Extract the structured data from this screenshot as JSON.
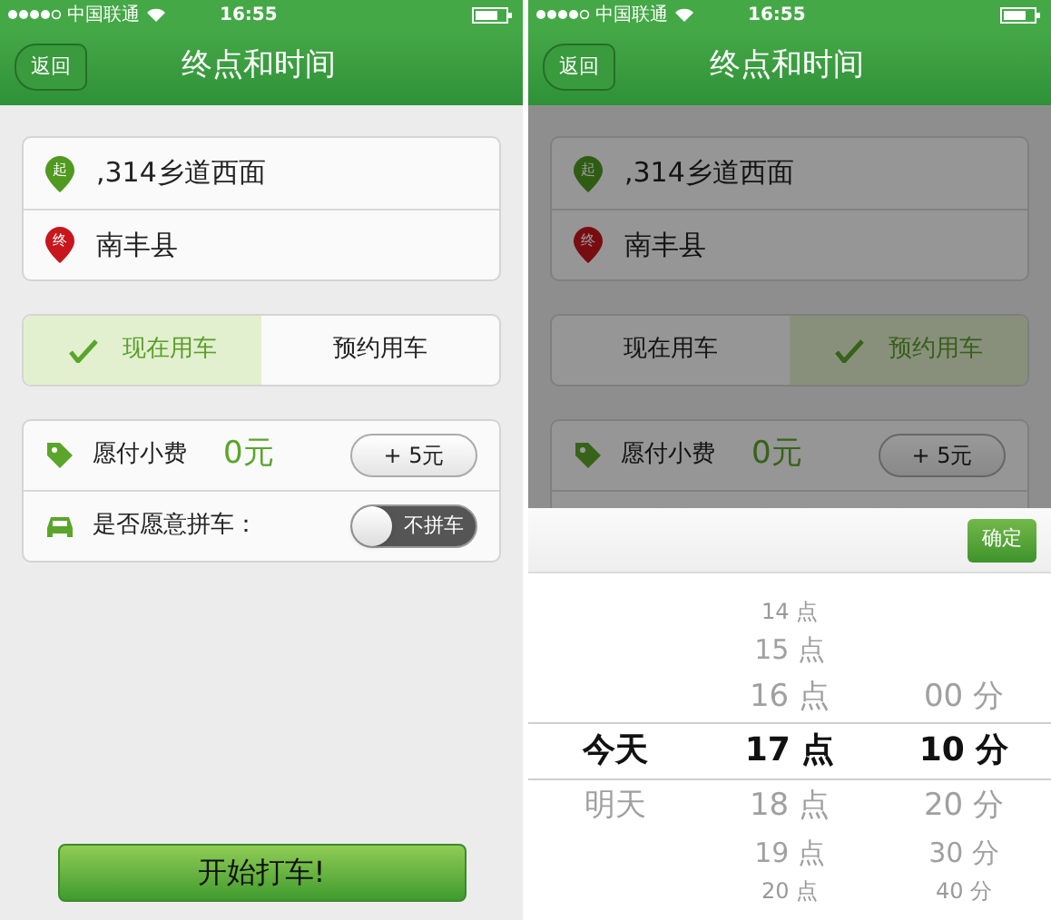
{
  "screens": [
    {
      "dimmed": false,
      "status_bar": {
        "carrier": "中国联通",
        "time": "16:55"
      },
      "nav": {
        "back": "返回",
        "title": "终点和时间"
      },
      "addresses": [
        {
          "kind": "start",
          "badge": "起",
          "text": ",314乡道西面"
        },
        {
          "kind": "end",
          "badge": "终",
          "text": "南丰县"
        }
      ],
      "mode_tabs": [
        {
          "label": "现在用车",
          "selected": true
        },
        {
          "label": "预约用车",
          "selected": false
        }
      ],
      "fee": {
        "label": "愿付小费",
        "value": "0元",
        "button": "+ 5元"
      },
      "carpool": {
        "label": "是否愿意拼车：",
        "switch_label": "不拼车",
        "on": false
      },
      "submit_button": "开始打车!"
    },
    {
      "dimmed": true,
      "status_bar": {
        "carrier": "中国联通",
        "time": "16:55"
      },
      "nav": {
        "back": "返回",
        "title": "终点和时间"
      },
      "addresses": [
        {
          "kind": "start",
          "badge": "起",
          "text": ",314乡道西面"
        },
        {
          "kind": "end",
          "badge": "终",
          "text": "南丰县"
        }
      ],
      "mode_tabs": [
        {
          "label": "现在用车",
          "selected": false
        },
        {
          "label": "预约用车",
          "selected": true
        }
      ],
      "fee": {
        "label": "愿付小费",
        "value": "0元",
        "button": "+ 5元"
      },
      "picker": {
        "confirm": "确定",
        "columns": [
          {
            "items": [
              {
                "label": "今天",
                "selected": true
              },
              {
                "label": "明天",
                "selected": false
              }
            ]
          },
          {
            "items": [
              {
                "label": "14 点",
                "selected": false
              },
              {
                "label": "15 点",
                "selected": false
              },
              {
                "label": "16 点",
                "selected": false
              },
              {
                "label": "17 点",
                "selected": true
              },
              {
                "label": "18 点",
                "selected": false
              },
              {
                "label": "19 点",
                "selected": false
              },
              {
                "label": "20 点",
                "selected": false
              }
            ]
          },
          {
            "items": [
              {
                "label": "00 分",
                "selected": false
              },
              {
                "label": "10 分",
                "selected": true
              },
              {
                "label": "20 分",
                "selected": false
              },
              {
                "label": "30 分",
                "selected": false
              },
              {
                "label": "40 分",
                "selected": false
              }
            ]
          }
        ]
      }
    }
  ]
}
